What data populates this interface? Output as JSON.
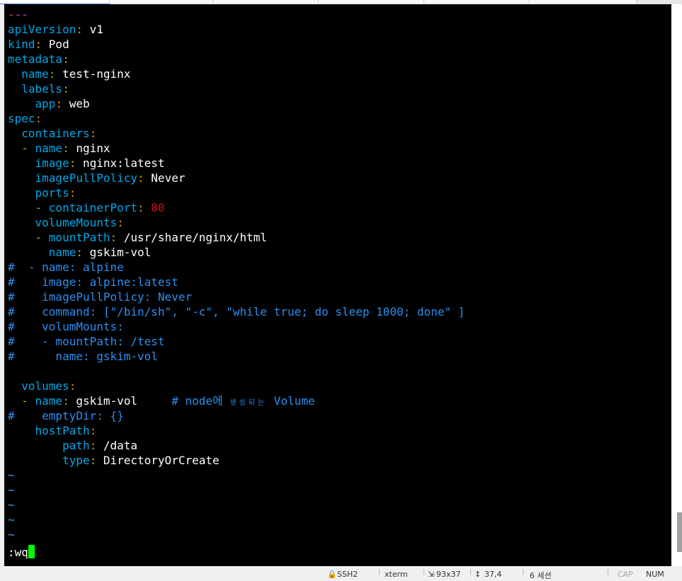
{
  "editor": {
    "lines": [
      [
        {
          "t": "---",
          "c": "d"
        }
      ],
      [
        {
          "t": "apiVersion",
          "c": "k"
        },
        {
          "t": ": ",
          "c": "p"
        },
        {
          "t": "v1",
          "c": "v"
        }
      ],
      [
        {
          "t": "kind",
          "c": "k"
        },
        {
          "t": ": ",
          "c": "p"
        },
        {
          "t": "Pod",
          "c": "v"
        }
      ],
      [
        {
          "t": "metadata",
          "c": "k"
        },
        {
          "t": ":",
          "c": "p"
        }
      ],
      [
        {
          "t": "  name",
          "c": "k"
        },
        {
          "t": ": ",
          "c": "p"
        },
        {
          "t": "test-nginx",
          "c": "v"
        }
      ],
      [
        {
          "t": "  labels",
          "c": "k"
        },
        {
          "t": ":",
          "c": "p"
        }
      ],
      [
        {
          "t": "    app",
          "c": "k"
        },
        {
          "t": ": ",
          "c": "p"
        },
        {
          "t": "web",
          "c": "v"
        }
      ],
      [
        {
          "t": "spec",
          "c": "k"
        },
        {
          "t": ":",
          "c": "p"
        }
      ],
      [
        {
          "t": "  containers",
          "c": "k"
        },
        {
          "t": ":",
          "c": "p"
        }
      ],
      [
        {
          "t": "  - ",
          "c": "p"
        },
        {
          "t": "name",
          "c": "k"
        },
        {
          "t": ": ",
          "c": "p"
        },
        {
          "t": "nginx",
          "c": "v"
        }
      ],
      [
        {
          "t": "    image",
          "c": "k"
        },
        {
          "t": ": ",
          "c": "p"
        },
        {
          "t": "nginx:latest",
          "c": "v"
        }
      ],
      [
        {
          "t": "    imagePullPolicy",
          "c": "k"
        },
        {
          "t": ": ",
          "c": "p"
        },
        {
          "t": "Never",
          "c": "v"
        }
      ],
      [
        {
          "t": "    ports",
          "c": "k"
        },
        {
          "t": ":",
          "c": "p"
        }
      ],
      [
        {
          "t": "    - ",
          "c": "p"
        },
        {
          "t": "containerPort",
          "c": "k"
        },
        {
          "t": ": ",
          "c": "p"
        },
        {
          "t": "80",
          "c": "n"
        }
      ],
      [
        {
          "t": "    volumeMounts",
          "c": "k"
        },
        {
          "t": ":",
          "c": "p"
        }
      ],
      [
        {
          "t": "    - ",
          "c": "p"
        },
        {
          "t": "mountPath",
          "c": "k"
        },
        {
          "t": ": ",
          "c": "p"
        },
        {
          "t": "/usr/share/nginx/html",
          "c": "v"
        }
      ],
      [
        {
          "t": "      name",
          "c": "k"
        },
        {
          "t": ": ",
          "c": "p"
        },
        {
          "t": "gskim-vol",
          "c": "v"
        }
      ],
      [
        {
          "t": "#  - name: alpine",
          "c": "c"
        }
      ],
      [
        {
          "t": "#    image: alpine:latest",
          "c": "c"
        }
      ],
      [
        {
          "t": "#    imagePullPolicy: Never",
          "c": "c"
        }
      ],
      [
        {
          "t": "#    command: [\"/bin/sh\", \"-c\", \"while true; do sleep 1000; done\" ]",
          "c": "c"
        }
      ],
      [
        {
          "t": "#    volumMounts:",
          "c": "c"
        }
      ],
      [
        {
          "t": "#    - mountPath: /test",
          "c": "c"
        }
      ],
      [
        {
          "t": "#      name: gskim-vol",
          "c": "c"
        }
      ],
      [],
      [
        {
          "t": "  volumes",
          "c": "k"
        },
        {
          "t": ":",
          "c": "p"
        }
      ],
      [
        {
          "t": "  - ",
          "c": "p"
        },
        {
          "t": "name",
          "c": "k"
        },
        {
          "t": ": ",
          "c": "p"
        },
        {
          "t": "gskim-vol",
          "c": "v"
        },
        {
          "t": "     # node에 ",
          "c": "c"
        },
        {
          "t": "생성되는",
          "c": "c ko"
        },
        {
          "t": " Volume",
          "c": "c"
        }
      ],
      [
        {
          "t": "#    emptyDir: {}",
          "c": "c"
        }
      ],
      [
        {
          "t": "    hostPath",
          "c": "k"
        },
        {
          "t": ":",
          "c": "p"
        }
      ],
      [
        {
          "t": "        path",
          "c": "k"
        },
        {
          "t": ": ",
          "c": "p"
        },
        {
          "t": "/data",
          "c": "v"
        }
      ],
      [
        {
          "t": "        type",
          "c": "k"
        },
        {
          "t": ": ",
          "c": "p"
        },
        {
          "t": "DirectoryOrCreate",
          "c": "v"
        }
      ],
      [
        {
          "t": "~",
          "c": "t"
        }
      ],
      [
        {
          "t": "~",
          "c": "t"
        }
      ],
      [
        {
          "t": "~",
          "c": "t"
        }
      ],
      [
        {
          "t": "~",
          "c": "t"
        }
      ],
      [
        {
          "t": "~",
          "c": "t"
        }
      ]
    ],
    "command_line": ":wq"
  },
  "statusbar": {
    "items": [
      "SSH2",
      "xterm",
      "93x37",
      "37,4",
      "6 세션",
      "CAP",
      "NUM"
    ]
  }
}
